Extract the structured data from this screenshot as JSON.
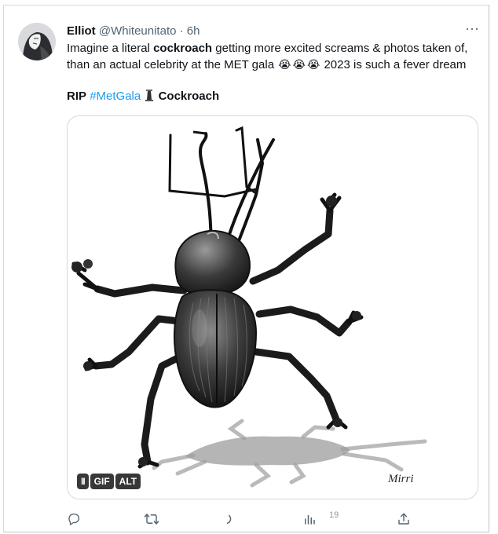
{
  "tweet": {
    "author_name": "Elliot",
    "handle": "@Whiteunitato",
    "separator": "·",
    "time": "6h",
    "more_label": "···",
    "text_pre": "Imagine a literal ",
    "text_bold": "cockroach",
    "text_post": " getting more excited screams & photos taken of, than an actual celebrity at the MET gala",
    "emojis": [
      "😭",
      "😭",
      "😭"
    ],
    "text_end": " 2023 is such a fever dream",
    "rip": "RIP",
    "hashtag": "#MetGala",
    "hashtag_icon": "met-gala-emoji-icon",
    "hashtag_suffix": " Cockroach"
  },
  "media": {
    "type": "gif",
    "subject": "cockroach-illustration",
    "signature_text": "Mirri",
    "badges": {
      "pause": "II",
      "gif": "GIF",
      "alt": "ALT"
    }
  },
  "actions": {
    "reply_icon": "reply-icon",
    "retweet_icon": "retweet-icon",
    "like_icon": "like-icon",
    "views_icon": "views-icon",
    "views_count": "19",
    "share_icon": "share-icon"
  },
  "colors": {
    "accent": "#1d9bf0",
    "text": "#0f1419",
    "secondary": "#536471",
    "border": "#cfd9de"
  }
}
